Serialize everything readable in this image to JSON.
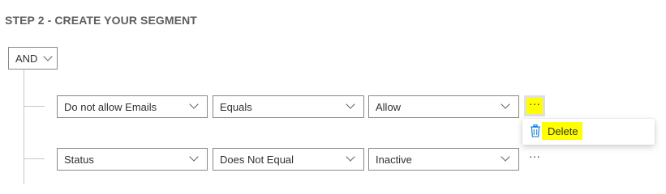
{
  "step": {
    "title": "STEP 2 - CREATE YOUR SEGMENT"
  },
  "group": {
    "operator": "AND"
  },
  "conditions": [
    {
      "attribute": "Do not allow Emails",
      "operator": "Equals",
      "value": "Allow",
      "more_label": "···",
      "more_active": true
    },
    {
      "attribute": "Status",
      "operator": "Does Not Equal",
      "value": "Inactive",
      "more_label": "···",
      "more_active": false
    }
  ],
  "context_menu": {
    "items": [
      {
        "label": "Delete",
        "icon": "trash-icon"
      }
    ]
  },
  "colors": {
    "highlight": "#ffff00",
    "icon_blue": "#0078d4",
    "border": "#8a8886",
    "tree_line": "#c8c6c4"
  }
}
